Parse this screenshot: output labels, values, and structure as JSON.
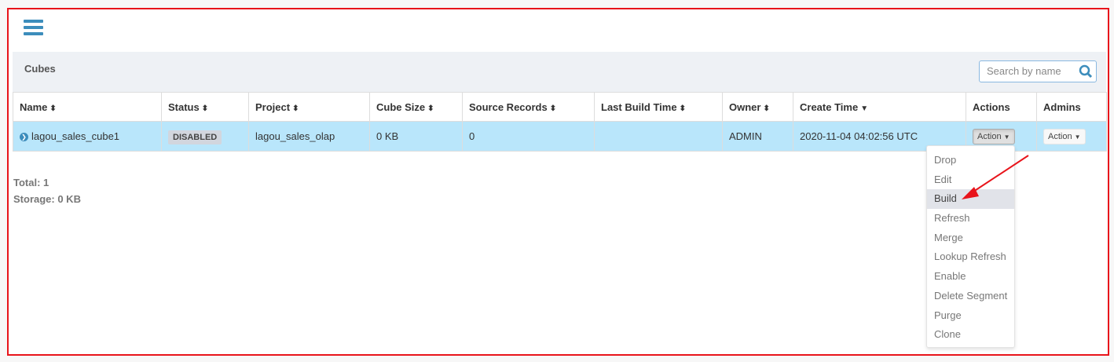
{
  "panel": {
    "title": "Cubes"
  },
  "search": {
    "placeholder": "Search by name"
  },
  "table": {
    "columns": [
      "Name",
      "Status",
      "Project",
      "Cube Size",
      "Source Records",
      "Last Build Time",
      "Owner",
      "Create Time",
      "Actions",
      "Admins"
    ],
    "rows": [
      {
        "name": "lagou_sales_cube1",
        "status": "DISABLED",
        "project": "lagou_sales_olap",
        "cube_size": "0 KB",
        "source_records": "0",
        "last_build_time": "",
        "owner": "ADMIN",
        "create_time": "2020-11-04 04:02:56 UTC",
        "actions": "Action",
        "admins": "Action"
      }
    ]
  },
  "summary": {
    "total": "Total: 1",
    "storage": "Storage: 0 KB"
  },
  "action_menu": {
    "items": [
      "Drop",
      "Edit",
      "Build",
      "Refresh",
      "Merge",
      "Lookup Refresh",
      "Enable",
      "Delete Segment",
      "Purge",
      "Clone"
    ],
    "highlighted": "Build"
  },
  "colors": {
    "accent": "#3c8dbc",
    "row_selected": "#b9e6fb",
    "annotation": "#e8141b"
  }
}
